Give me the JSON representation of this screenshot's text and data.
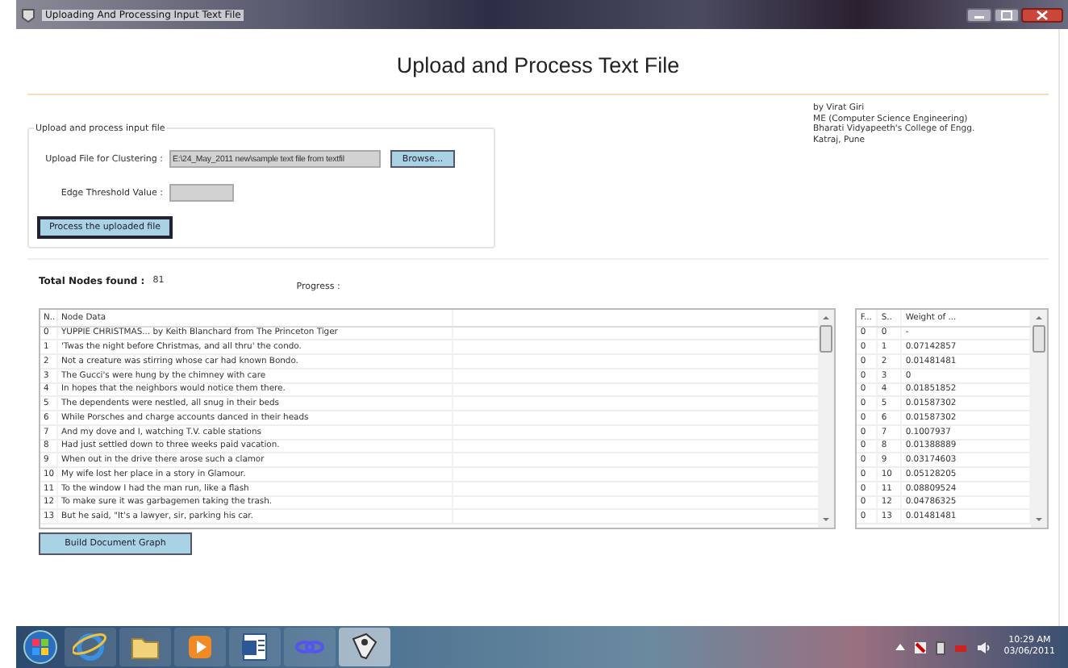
{
  "window": {
    "title": "Uploading And Processing Input Text File"
  },
  "heading": "Upload and Process Text File",
  "author_lines": [
    "by Virat Giri",
    "ME (Computer Science  Engineering)",
    "Bharati Vidyapeeth's College of Engg.",
    "Katraj, Pune"
  ],
  "input_group": {
    "legend": "Upload and process input file",
    "fields": [
      {
        "label": "Upload File for Clustering :",
        "value": "E:\\24_May_2011 new\\sample text file from textfil"
      },
      {
        "label": "Edge Threshold Value :"
      }
    ],
    "browse_button": "Browse...",
    "process_button": "Process the uploaded file"
  },
  "total_nodes": {
    "label": "Total Nodes found :",
    "value": "81"
  },
  "progress": {
    "label": "Progress :"
  },
  "nodes_table": {
    "columns": [
      "N..",
      "Node Data"
    ],
    "rows": [
      [
        "0",
        "YUPPIE CHRISTMAS...  by Keith Blanchard  from The Princeton Tiger"
      ],
      [
        "1",
        "'Twas the night before Christmas, and all thru' the condo."
      ],
      [
        "2",
        "Not a creature was stirring whose car had known Bondo."
      ],
      [
        "3",
        "The Gucci's were hung by the chimney with care"
      ],
      [
        "4",
        "In hopes that the neighbors would notice them there."
      ],
      [
        "5",
        "The dependents were nestled, all snug in their beds"
      ],
      [
        "6",
        "While Porsches and charge accounts danced in their heads"
      ],
      [
        "7",
        "And my dove and I, watching T.V. cable stations"
      ],
      [
        "8",
        "Had just settled down to three weeks paid vacation."
      ],
      [
        "9",
        "When out in the drive there arose such a clamor"
      ],
      [
        "10",
        "My wife lost her place in a story in Glamour."
      ],
      [
        "11",
        "To the window I had the man run, like a flash"
      ],
      [
        "12",
        "To make sure it was garbagemen taking the trash."
      ],
      [
        "13",
        "But he said, \"It's a lawyer, sir, parking his car."
      ]
    ]
  },
  "weights_table": {
    "columns": [
      "F...",
      "S..",
      "Weight of ..."
    ],
    "rows": [
      [
        "0",
        "0",
        "-"
      ],
      [
        "0",
        "1",
        "0.07142857"
      ],
      [
        "0",
        "2",
        "0.01481481"
      ],
      [
        "0",
        "3",
        "0"
      ],
      [
        "0",
        "4",
        "0.01851852"
      ],
      [
        "0",
        "5",
        "0.01587302"
      ],
      [
        "0",
        "6",
        "0.01587302"
      ],
      [
        "0",
        "7",
        "0.1007937"
      ],
      [
        "0",
        "8",
        "0.01388889"
      ],
      [
        "0",
        "9",
        "0.03174603"
      ],
      [
        "0",
        "10",
        "0.05128205"
      ],
      [
        "0",
        "11",
        "0.08809524"
      ],
      [
        "0",
        "12",
        "0.04786325"
      ],
      [
        "0",
        "13",
        "0.01481481"
      ]
    ]
  },
  "build_button": "Build Document Graph",
  "taskbar": {
    "items": [
      {
        "kind": "start",
        "selected": false
      },
      {
        "kind": "browser",
        "selected": false
      },
      {
        "kind": "folder",
        "selected": false
      },
      {
        "kind": "media",
        "selected": false
      },
      {
        "kind": "document",
        "selected": false
      },
      {
        "kind": "app",
        "selected": false
      },
      {
        "kind": "tool",
        "selected": true
      }
    ],
    "time": "10:29 AM",
    "date": "03/06/2011"
  }
}
